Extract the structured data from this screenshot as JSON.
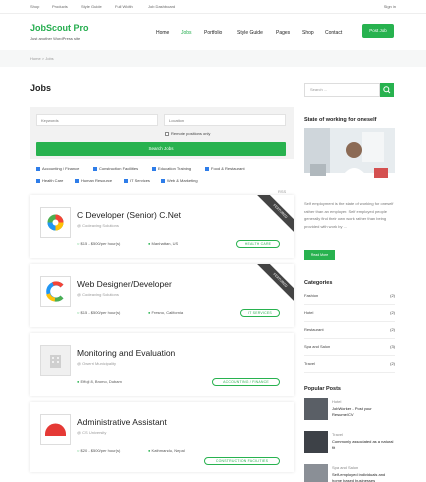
{
  "topbar": {
    "links": [
      "Shop",
      "Products",
      "Style Guide",
      "Full Width",
      "Job Dashboard"
    ],
    "signin": "Sign in"
  },
  "header": {
    "logo": "JobScout Pro",
    "tagline": "Just another WordPress site",
    "nav": [
      "Home",
      "Jobs",
      "Portfolio",
      "Style Guide",
      "Pages",
      "Shop",
      "Contact"
    ],
    "active_nav": "Jobs",
    "post_job": "Post Job"
  },
  "breadcrumb": "Home > Jobs",
  "page_title": "Jobs",
  "search": {
    "keywords_placeholder": "Keywords",
    "location_placeholder": "Location",
    "remote_label": "Remote positions only",
    "button": "Search Jobs",
    "categories": [
      "Accounting / Finance",
      "Construction Facilities",
      "Education Training",
      "Food & Restaurant",
      "Health Care",
      "Human Resource",
      "IT Services",
      "Web & Marketing"
    ]
  },
  "rss": "RSS",
  "jobs": [
    {
      "title": "C Developer (Senior) C.Net",
      "company": "@ Codeaving Solutions",
      "salary": "$15 - $500/per hour(s)",
      "location": "Manhattan, US",
      "category": "HEALTH CARE",
      "ribbon": "FEATURED",
      "logo": "pinwheel-logo"
    },
    {
      "title": "Web Designer/Developer",
      "company": "@ Codeaving Solutions",
      "salary": "$15 - $500/per hour(s)",
      "location": "Fresno, California",
      "category": "IT SERVICES",
      "ribbon": "FEATURED",
      "logo": "c-logo"
    },
    {
      "title": "Monitoring and Evaluation",
      "company": "@ Owerri Municipality",
      "salary": "",
      "location": "Effoji 8, Bromo, Dubam",
      "category": "ACCOUNTING / FINANCE",
      "ribbon": "",
      "logo": "building-placeholder"
    },
    {
      "title": "Administrative Assistant",
      "company": "@ CS University",
      "salary": "$20 - $500/per hour(s)",
      "location": "Kathmandu, Nepal",
      "category": "CONSTRUCTION FACILITIES",
      "ribbon": "",
      "logo": "red-half-logo"
    }
  ],
  "sidebar": {
    "search_placeholder": "Search ...",
    "featured_heading": "State of working for oneself",
    "featured_text": "Self employment is the state of working for oneself rather than an employer. Self employed people generally find their own work rather than being provided with work by ...",
    "read_more": "Read More",
    "categories_heading": "Categories",
    "categories": [
      {
        "name": "Fashion",
        "count": "(2)"
      },
      {
        "name": "Hotel",
        "count": "(2)"
      },
      {
        "name": "Restaurant",
        "count": "(2)"
      },
      {
        "name": "Spa and Salon",
        "count": "(3)"
      },
      {
        "name": "Travel",
        "count": "(2)"
      }
    ],
    "popular_heading": "Popular Posts",
    "posts": [
      {
        "category": "Hotel",
        "title": "JobWorker - Post your Resume/CV"
      },
      {
        "category": "Travel",
        "title": "Commonly associated as a natural fit"
      },
      {
        "category": "Spa and Salon",
        "title": "Self-employed individuals and home based businesses"
      }
    ]
  },
  "colors": {
    "accent": "#28b24f",
    "ribbon": "#444444"
  }
}
